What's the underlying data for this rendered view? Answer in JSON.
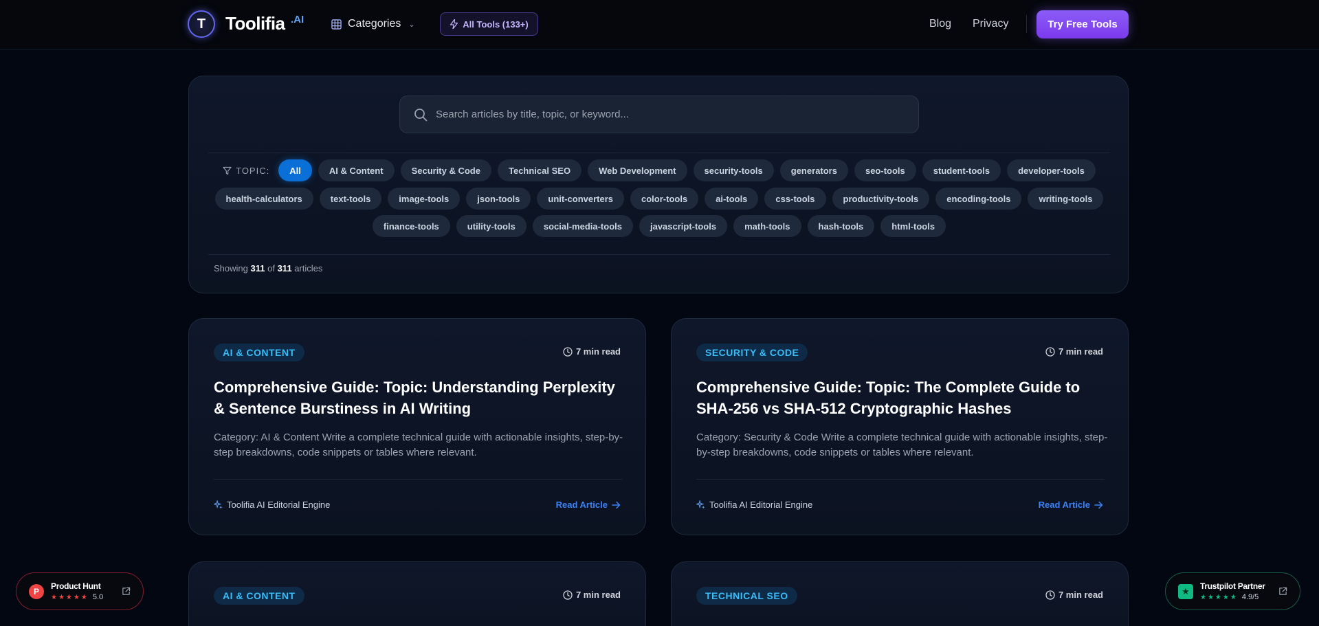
{
  "header": {
    "logo_mark": "T",
    "logo_text": "Toolifia",
    "logo_ai": ".AI",
    "categories_label": "Categories",
    "all_tools_label": "All Tools (133+)",
    "nav": {
      "blog": "Blog",
      "privacy": "Privacy"
    },
    "cta_label": "Try Free Tools"
  },
  "search": {
    "placeholder": "Search articles by title, topic, or keyword...",
    "value": ""
  },
  "filter": {
    "topic_label": "TOPIC:",
    "selected": "All",
    "chips_row1": [
      "All",
      "AI & Content",
      "Security & Code",
      "Technical SEO",
      "Web Development",
      "security-tools",
      "generators",
      "seo-tools",
      "student-tools",
      "developer-tools"
    ],
    "chips_row2": [
      "health-calculators",
      "text-tools",
      "image-tools",
      "json-tools",
      "unit-converters",
      "color-tools",
      "ai-tools",
      "css-tools",
      "productivity-tools",
      "encoding-tools",
      "writing-tools"
    ],
    "chips_row3": [
      "finance-tools",
      "utility-tools",
      "social-media-tools",
      "javascript-tools",
      "math-tools",
      "hash-tools",
      "html-tools"
    ],
    "showing_prefix": "Showing",
    "showing_count": "311",
    "showing_of": "of",
    "showing_total": "311",
    "showing_suffix": "articles"
  },
  "articles": [
    {
      "category": "AI & CONTENT",
      "read_time": "7 min read",
      "title": "Comprehensive Guide: Topic: Understanding Perplexity & Sentence Burstiness in AI Writing",
      "description": "Category: AI & Content Write a complete technical guide with actionable insights, step-by-step breakdowns, code snippets or tables where relevant.",
      "author": "Toolifia AI Editorial Engine",
      "link_label": "Read Article"
    },
    {
      "category": "SECURITY & CODE",
      "read_time": "7 min read",
      "title": "Comprehensive Guide: Topic: The Complete Guide to SHA-256 vs SHA-512 Cryptographic Hashes",
      "description": "Category: Security & Code Write a complete technical guide with actionable insights, step-by-step breakdowns, code snippets or tables where relevant.",
      "author": "Toolifia AI Editorial Engine",
      "link_label": "Read Article"
    },
    {
      "category": "AI & CONTENT",
      "read_time": "7 min read"
    },
    {
      "category": "TECHNICAL SEO",
      "read_time": "7 min read"
    }
  ],
  "badges": {
    "product_hunt": {
      "logo": "P",
      "title": "Product Hunt",
      "stars": "★★★★★",
      "rating": "5.0"
    },
    "trustpilot": {
      "logo": "★",
      "title": "Trustpilot Partner",
      "stars": "★★★★★",
      "rating": "4.9/5"
    }
  },
  "colors": {
    "background": "#030712",
    "accent_purple": "#7c3aed",
    "accent_blue": "#0a6fd6",
    "badge_text": "#38bdf8",
    "product_hunt": "#ef4444",
    "trustpilot": "#10b981"
  }
}
